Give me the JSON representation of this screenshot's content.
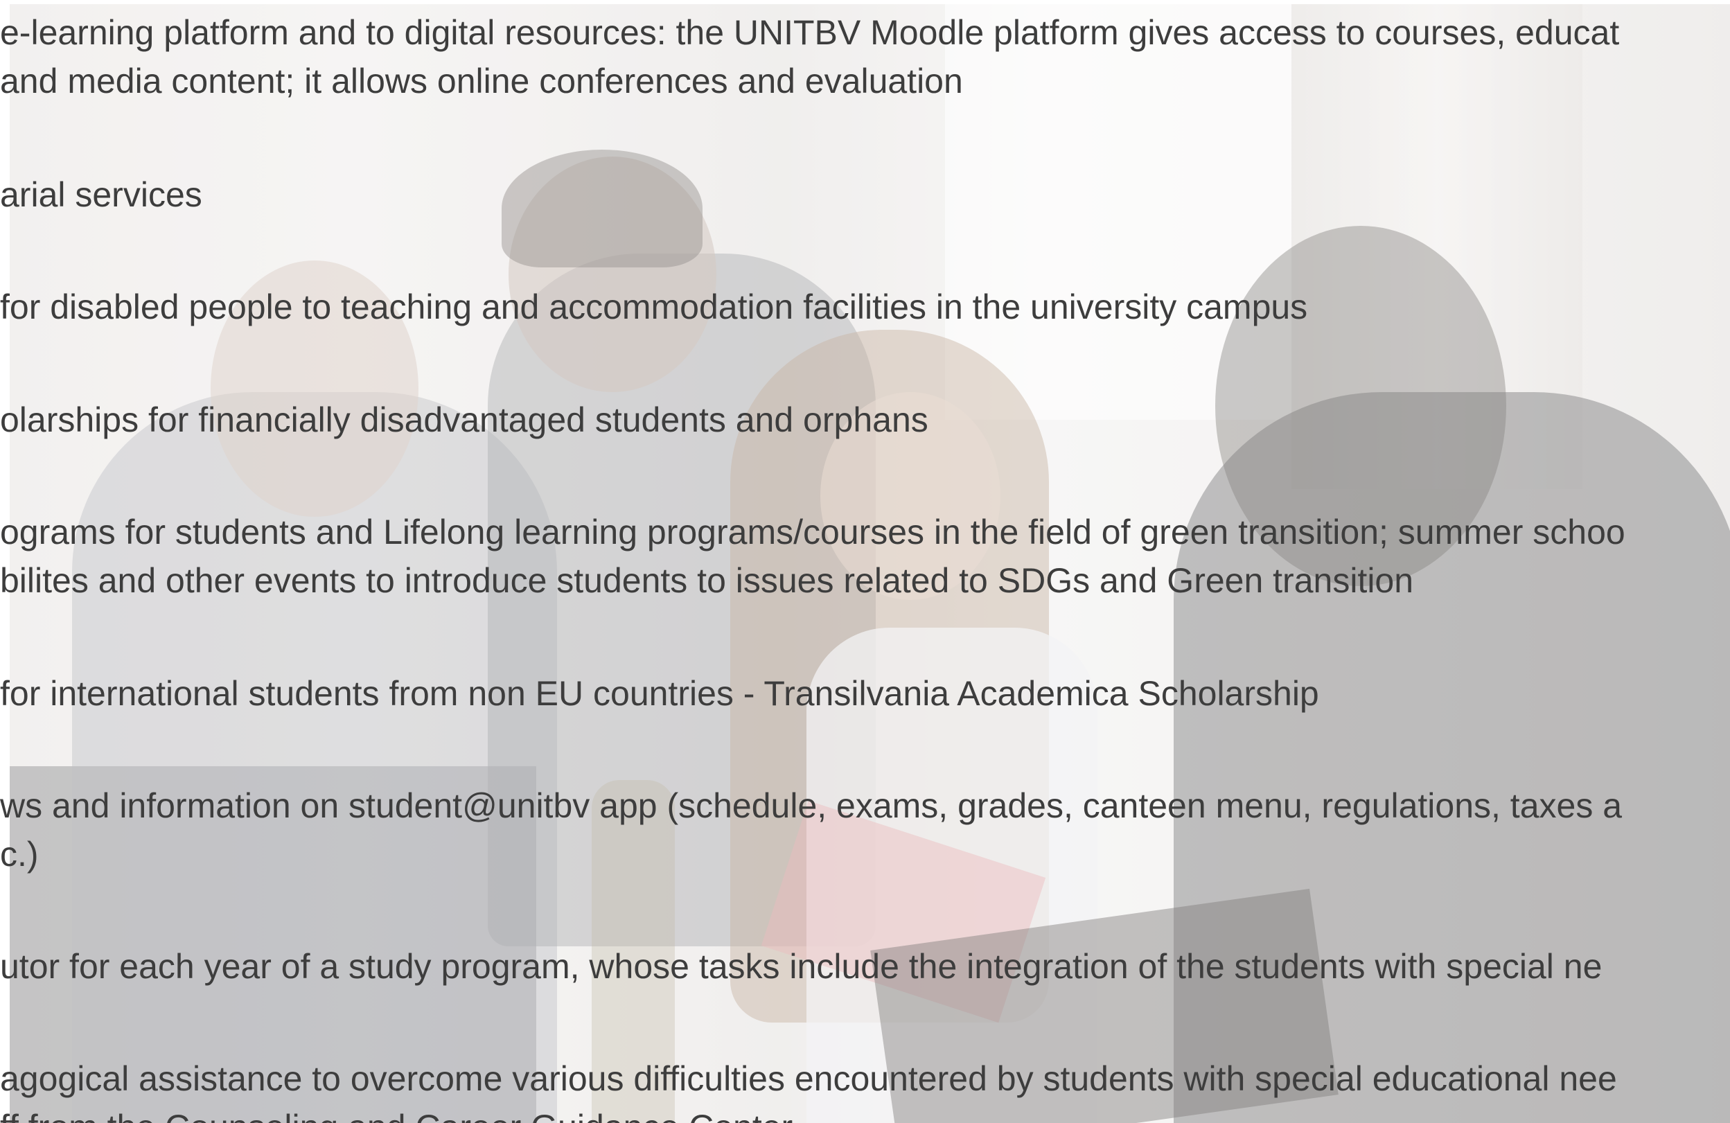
{
  "items": [
    {
      "lines": [
        "e-learning platform and to digital resources: the UNITBV Moodle platform gives access to courses, educat",
        " and media content; it allows online conferences and evaluation"
      ]
    },
    {
      "lines": [
        "arial services"
      ]
    },
    {
      "lines": [
        "for disabled people to teaching and accommodation facilities in the university campus"
      ]
    },
    {
      "lines": [
        "olarships for financially disadvantaged students and orphans"
      ]
    },
    {
      "lines": [
        "ograms for students and Lifelong learning programs/courses in the field of green transition; summer schoo",
        "bilites and other events to introduce students to issues related to SDGs and Green transition"
      ]
    },
    {
      "lines": [
        "for international students from non EU countries - Transilvania Academica Scholarship"
      ]
    },
    {
      "lines": [
        "ws and information on student@unitbv app (schedule, exams, grades, canteen menu, regulations, taxes a",
        "c.)"
      ]
    },
    {
      "lines": [
        "utor for each year of a study program, whose tasks include the integration of the students with special ne"
      ]
    },
    {
      "lines": [
        "agogical assistance to overcome various difficulties encountered by students with special educational nee",
        "ff from the Counseling and Career Guidance Center"
      ]
    }
  ]
}
